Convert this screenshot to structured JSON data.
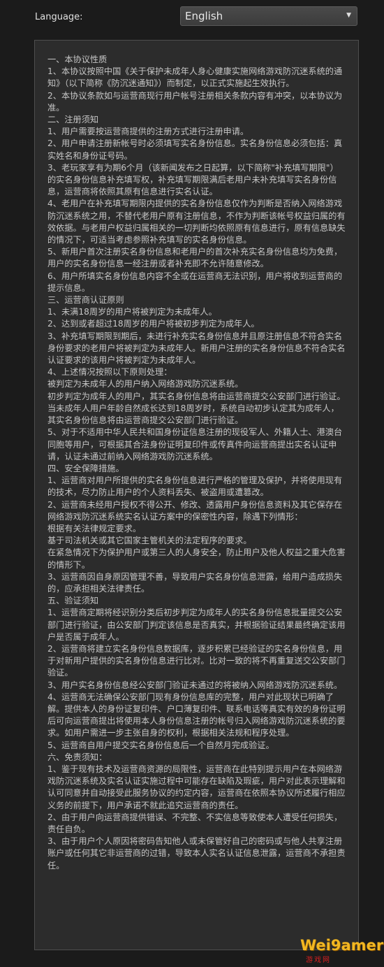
{
  "language": {
    "label": "Language:",
    "selected": "English"
  },
  "agreement": {
    "lines": [
      "一、本协议性质",
      "1、本协议按照中国《关于保护未成年人身心健康实施网络游戏防沉迷系统的通知》（以下简称《防沉迷通知》）而制定，以正式实施起生效执行。",
      "2、本协议条款如与运营商现行用户帐号注册相关条款内容有冲突，以本协议为准。",
      "二、注册须知",
      "1、用户需要按运营商提供的注册方式进行注册申请。",
      "2、用户申请注册新帐号时必须填写实名身份信息。实名身份信息必须包括：真实姓名和身份证号码。",
      "3、老玩家享有为期6个月（该新闻发布之日起算，以下简称\"补充填写期限\"）的实名身份信息补充填写权，补充填写期限满后老用户未补充填写实名身份信息，运营商将依照其原有信息进行实名认证。",
      "4、老用户在补充填写期限内提供的实名身份信息仅作为判断是否纳入网络游戏防沉迷系统之用，不替代老用户原有注册信息，不作为判断该帐号权益归属的有效依据。与老用户权益归属相关的一切判断均依照原有信息进行，原有信息缺失的情况下，可适当考虑参照补充填写的实名身份信息。",
      "5、新用户首次注册实名身份信息和老用户的首次补充实名身份信息均为免费，用户的实名身份信息一经注册或者补充即不允许随意修改。",
      "6、用户所填实名身份信息内容不全或在运营商无法识别，用户将收到运营商的提示信息。",
      "三、运营商认证原则",
      "1、未满18周岁的用户将被判定为未成年人。",
      "2、达到或者超过18周岁的用户将被初步判定为成年人。",
      "3、补充填写期限到期后，未进行补充实名身份信息并且原注册信息不符合实名身份要求的老用户将被判定为未成年人。新用户注册的实名身份信息不符合实名认证要求的该用户将被判定为未成年人。",
      "4、上述情况按照以下原则处理：",
      "被判定为未成年人的用户纳入网络游戏防沉迷系统。",
      "初步判定为成年人的用户，其实名身份信息将由运营商提交公安部门进行验证。",
      "当未成年人用户年龄自然成长达到18周岁时，系统自动初步认定其为成年人，其实名身份信息将由运营商提交公安部门进行验证。",
      "5、对于不适用中华人民共和国身份证信息注册的现役军人、外籍人士、港澳台同胞等用户，可根据其合法身份证明复印件或传真件向运营商提出实名认证申请，认证未通过前纳入网络游戏防沉迷系统。",
      "四、安全保障措施。",
      "1、运营商对用户所提供的实名身份信息进行严格的管理及保护，并将使用现有 的技术，尽力防止用户的个人资料丢失、被盗用或遭篡改。",
      "2、运营商未经用户授权不得公开、修改、透露用户身份信息资料及其它保存在网络游戏防沉迷系统实名认证方案中的保密性内容，除遇下列情形：",
      "根据有关法律规定要求。",
      "基于司法机关或其它国家主管机关的法定程序的要求。",
      "在紧急情况下为保护用户或第三人的人身安全，防止用户及他人权益之重大危害的情形下。",
      "3、运营商因自身原因管理不善，导致用户实名身份信息泄露，给用户造成损失的，应承担相关法律责任。",
      "五、验证须知",
      "1、运营商定期将经识别分类后初步判定为成年人的实名身份信息批量提交公安部门进行验证，由公安部门判定该信息是否真实，并根据验证结果最终确定该用户是否属于成年人。",
      "2、运营商将建立实名身份信息数据库，逐步积累已经验证的实名身份信息，用于对新用户提供的实名身份信息进行比对。比对一致的将不再重复送交公安部门验证。",
      "3、用户实名身份信息经公安部门验证未通过的将被纳入网络游戏防沉迷系统。",
      "4、运营商无法确保公安部门现有身份信息库的完整，用户对此现状已明确了解。提供本人的身份证复印件、户口薄复印件、联系电话等真实有效的身份证明后可向运营商提出将使用本人身份信息注册的帐号归入网络游戏防沉迷系统的要求。如用户需进一步主张自身的权利，根据相关法规和程序处理。",
      "5、运营商自用户提交实名身份信息后一个自然月完成验证。",
      "六、免责须知：",
      "1、鉴于现有技术及运营商资源的局限性，运营商在此特别提示用户在本网络游戏防沉迷系统及实名认证实施过程中可能存在缺陷及瑕疵，用户对此表示理解和认可同意并自动接受此服务协议的约定内容，运营商在依照本协议所述履行相应义务的前提下，用户承诺不就此追究运营商的责任。",
      "2、由于用户向运营商提供错误、不完整、不实信息等致使本人遭受任何损失，责任自负。",
      "3、由于用户个人原因将密码告知他人或未保管好自己的密码或与他人共享注册账户或任何其它非运营商的过错，导致本人实名认证信息泄露，运营商不承担责任。"
    ]
  },
  "watermark": {
    "main": "Wei9amer",
    "sub": "游戏网"
  }
}
